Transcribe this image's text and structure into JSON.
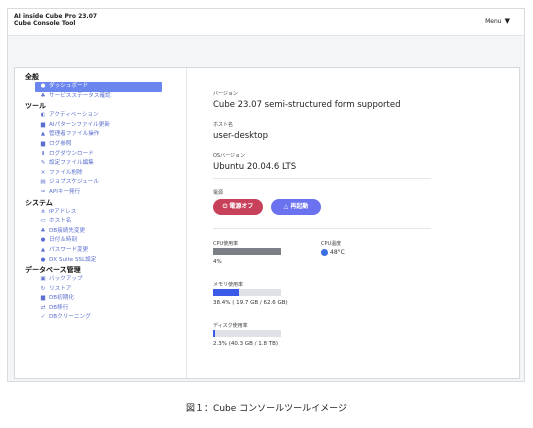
{
  "header": {
    "title_line1": "AI inside Cube Pro 23.07",
    "title_line2": "Cube Console Tool",
    "menu_label": "Menu",
    "menu_icon": "caret-down-icon"
  },
  "sidebar": {
    "sections": [
      {
        "title": "全般",
        "items": [
          {
            "icon": "●",
            "label": "ダッシュボード",
            "active": true
          },
          {
            "icon": "♣",
            "label": "サービスステータス確認"
          }
        ]
      },
      {
        "title": "ツール",
        "items": [
          {
            "icon": "◐",
            "label": "アクティベーション"
          },
          {
            "icon": "▆",
            "label": "AIパターンファイル更新"
          },
          {
            "icon": "▲",
            "label": "管理者ファイル操作"
          },
          {
            "icon": "▆",
            "label": "ログ参照"
          },
          {
            "icon": "⬇",
            "label": "ログダウンロード"
          },
          {
            "icon": "✎",
            "label": "設定ファイル編集"
          },
          {
            "icon": "✕",
            "label": "ファイル削除"
          },
          {
            "icon": "▤",
            "label": "ジョブスケジュール"
          },
          {
            "icon": "✑",
            "label": "APIキー発行"
          }
        ]
      },
      {
        "title": "システム",
        "items": [
          {
            "icon": "⋔",
            "label": "IPアドレス"
          },
          {
            "icon": "▭",
            "label": "ホスト名"
          },
          {
            "icon": "♣",
            "label": "DB接続先変更"
          },
          {
            "icon": "●",
            "label": "日付＆時刻"
          },
          {
            "icon": "▲",
            "label": "パスワード変更"
          },
          {
            "icon": "●",
            "label": "DX Suite SSL設定"
          }
        ]
      },
      {
        "title": "データベース管理",
        "items": [
          {
            "icon": "▣",
            "label": "バックアップ"
          },
          {
            "icon": "↻",
            "label": "リストア"
          },
          {
            "icon": "▆",
            "label": "DB初期化"
          },
          {
            "icon": "⇄",
            "label": "DB移行"
          },
          {
            "icon": "✓",
            "label": "DBクリーニング"
          }
        ]
      }
    ]
  },
  "main": {
    "version_label": "バージョン",
    "version_value": "Cube 23.07 semi-structured form supported",
    "host_label": "ホスト名",
    "host_value": "user-desktop",
    "os_label": "OSバージョン",
    "os_value": "Ubuntu 20.04.6 LTS",
    "power_label": "電源",
    "power_off_label": "電源オフ",
    "restart_label": "再起動",
    "cpu_label": "CPU使用率",
    "cpu_value": "4%",
    "cpu_fraction": 0.04,
    "cpu_temp_label": "CPU温度",
    "cpu_temp_value": "48°C",
    "mem_label": "メモリ使用率",
    "mem_value": "38.4% ( 19.7 GB / 62.6 GB)",
    "mem_fraction": 0.384,
    "disk_label": "ディスク使用率",
    "disk_value": "2.3% (40.3 GB / 1.8 TB)",
    "disk_fraction": 0.023
  },
  "caption": "図１：Cube コンソールツールイメージ",
  "colors": {
    "accent": "#6b86ee",
    "power_off": "#c8415a",
    "restart": "#6b72f0",
    "bar_fill": "#3b5ae8"
  }
}
